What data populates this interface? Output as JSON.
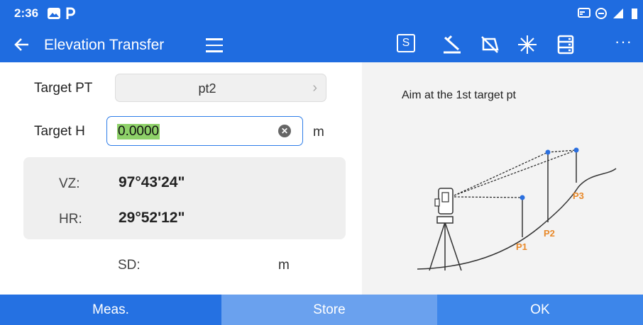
{
  "status_bar": {
    "time": "2:36"
  },
  "app_bar": {
    "title": "Elevation Transfer",
    "mode_label": "S",
    "more_label": "···"
  },
  "form": {
    "target_pt_label": "Target PT",
    "target_pt_value": "pt2",
    "target_h_label": "Target H",
    "target_h_value": "0.0000",
    "target_h_unit": "m"
  },
  "angles": {
    "vz_label": "VZ:",
    "vz_value": "97°43'24\"",
    "hr_label": "HR:",
    "hr_value": "29°52'12\""
  },
  "sd": {
    "label": "SD:",
    "value": "",
    "unit": "m"
  },
  "illustration": {
    "message": "Aim at the 1st target pt",
    "point_labels": [
      "P1",
      "P2",
      "P3"
    ],
    "point_label_color": "#e8892a",
    "target_dot_color": "#2a6fdf"
  },
  "buttons": {
    "meas": "Meas.",
    "store": "Store",
    "ok": "OK"
  },
  "colors": {
    "primary": "#1f6ce0",
    "button_meas": "#2571e2",
    "button_store": "#6aa1ee",
    "button_ok": "#3d86ea",
    "input_highlight": "#8ed169"
  }
}
